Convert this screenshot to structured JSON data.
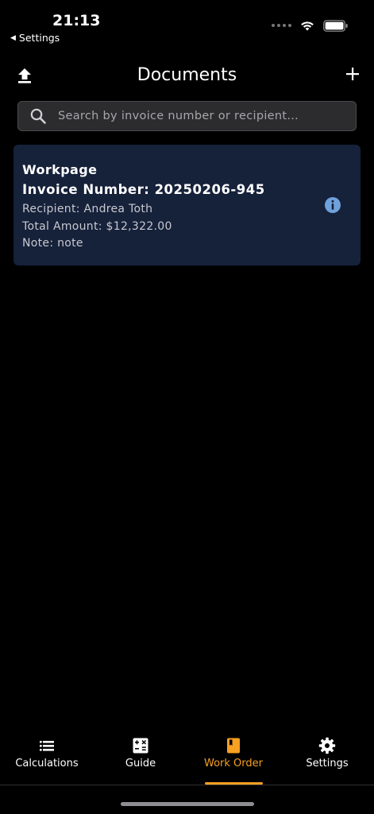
{
  "status_bar": {
    "time": "21:13",
    "back_label": "Settings"
  },
  "nav": {
    "title": "Documents",
    "upload_icon": "upload-icon",
    "add_icon": "plus-icon"
  },
  "search": {
    "placeholder": "Search by invoice number or recipient...",
    "value": ""
  },
  "documents": [
    {
      "title": "Workpage",
      "invoice": "Invoice Number: 20250206-945",
      "recipient": "Recipient: Andrea Toth",
      "total": "Total Amount: $12,322.00",
      "note": "Note: note"
    }
  ],
  "tabs": [
    {
      "label": "Calculations",
      "icon": "list-icon",
      "active": false
    },
    {
      "label": "Guide",
      "icon": "calculator-icon",
      "active": false
    },
    {
      "label": "Work Order",
      "icon": "book-icon",
      "active": true
    },
    {
      "label": "Settings",
      "icon": "gear-icon",
      "active": false
    }
  ],
  "colors": {
    "background": "#000000",
    "card": "#16213a",
    "accent": "#f7a021",
    "info": "#6fa2dc"
  }
}
